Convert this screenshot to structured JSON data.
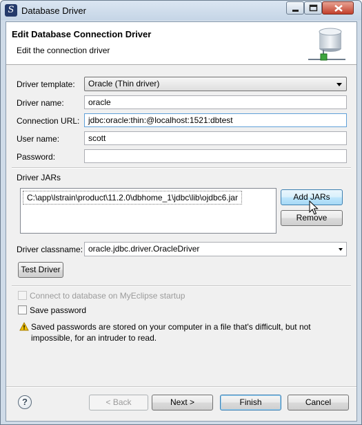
{
  "window": {
    "title": "Database Driver",
    "app_icon": "myeclipse-icon",
    "controls": [
      "minimize-icon",
      "maximize-icon",
      "close-icon"
    ]
  },
  "header": {
    "title": "Edit Database Connection Driver",
    "subtitle": "Edit the connection driver",
    "icon": "database-network-icon"
  },
  "form": {
    "template_label": "Driver template:",
    "template_value": "Oracle (Thin driver)",
    "name_label": "Driver name:",
    "name_value": "oracle",
    "url_label": "Connection URL:",
    "url_value": "jdbc:oracle:thin:@localhost:1521:dbtest",
    "user_label": "User name:",
    "user_value": "scott",
    "password_label": "Password:",
    "password_value": ""
  },
  "jars": {
    "label": "Driver JARs",
    "items": [
      "C:\\app\\lstrain\\product\\11.2.0\\dbhome_1\\jdbc\\lib\\ojdbc6.jar"
    ],
    "add_label": "Add JARs",
    "remove_label": "Remove"
  },
  "classname": {
    "label": "Driver classname:",
    "value": "oracle.jdbc.driver.OracleDriver"
  },
  "test_driver_label": "Test Driver",
  "options": {
    "connect_startup_label": "Connect to database on MyEclipse startup",
    "connect_startup_enabled": false,
    "save_password_label": "Save password",
    "save_password_checked": false
  },
  "warning": {
    "icon": "warning-icon",
    "text": "Saved passwords are stored on your computer in a file that's difficult, but not impossible, for an intruder to read."
  },
  "footer": {
    "help_icon": "help-icon",
    "help_glyph": "?",
    "back_label": "< Back",
    "next_label": "Next >",
    "finish_label": "Finish",
    "cancel_label": "Cancel"
  },
  "colors": {
    "titlebar": "#c5d5e6",
    "client_bg": "#f0f0f0",
    "hot_button": "#bee6fd",
    "warning": "#f2c200"
  }
}
